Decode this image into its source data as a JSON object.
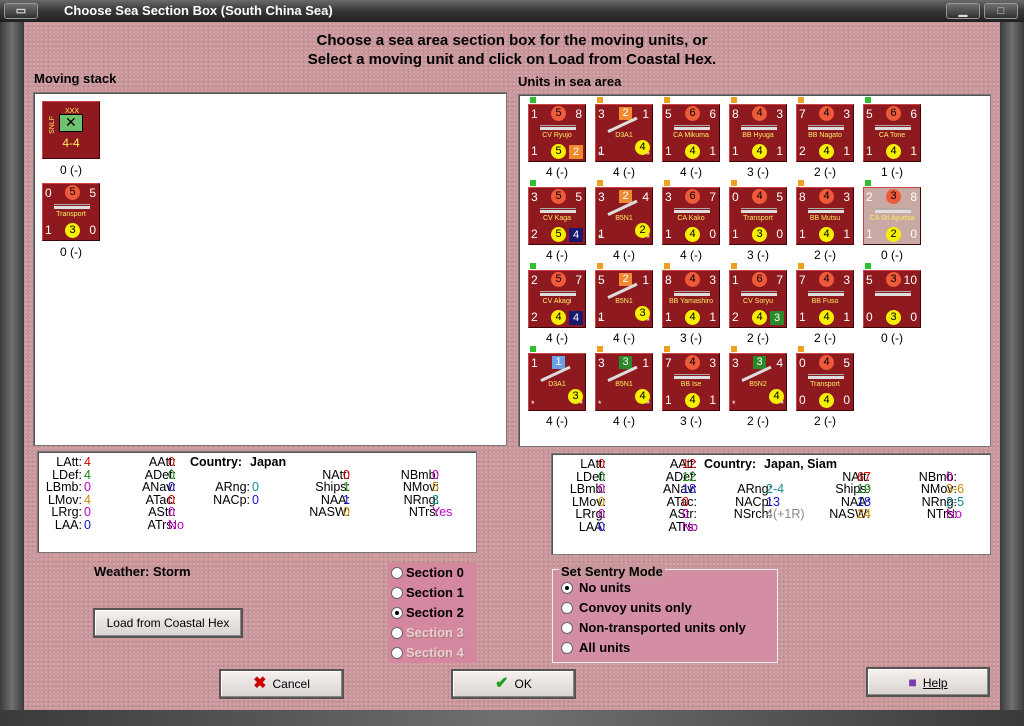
{
  "window": {
    "title": "Choose Sea Section Box (South China Sea)"
  },
  "instructions": {
    "line1": "Choose a sea area section box for the moving units, or",
    "line2": "Select a moving unit and click on Load from Coastal Hex."
  },
  "moving_stack": {
    "label": "Moving stack",
    "units": [
      {
        "id": "snlf",
        "tl": "",
        "tr": "",
        "name": "SNLF",
        "big": "4-4",
        "caption": "0 (-)",
        "mark": "XXX"
      },
      {
        "id": "transport",
        "tl": "0",
        "red": "5",
        "tr": "5",
        "name": "Transport",
        "bl": "1",
        "yel": "3",
        "br": "0",
        "caption": "0 (-)"
      }
    ]
  },
  "sea_units": {
    "label": "Units in sea area",
    "units": [
      {
        "tl": "1",
        "red": "5",
        "tr": "8",
        "name": "CV Ryujo",
        "bl": "1",
        "yel": "5",
        "sq": "2",
        "sqc": "#f08a30",
        "caption": "4 (-)"
      },
      {
        "tl": "3",
        "ora": "2",
        "tr": "1",
        "name": "D3A1",
        "bl": "1",
        "yelr": "4",
        "caption": "4 (-)",
        "plane": true
      },
      {
        "tl": "5",
        "red": "6",
        "tr": "6",
        "name": "CA Mikuma",
        "bl": "1",
        "yel": "4",
        "br": "1",
        "caption": "4 (-)"
      },
      {
        "tl": "8",
        "red": "4",
        "tr": "3",
        "name": "BB Hyuga",
        "bl": "1",
        "yel": "4",
        "br": "1",
        "caption": "3 (-)"
      },
      {
        "tl": "7",
        "red": "4",
        "tr": "3",
        "name": "BB Nagato",
        "bl": "2",
        "yel": "4",
        "br": "1",
        "caption": "2 (-)"
      },
      {
        "tl": "5",
        "red": "6",
        "tr": "6",
        "name": "CA Tone",
        "bl": "1",
        "yel": "4",
        "br": "1",
        "caption": "1 (-)"
      },
      {
        "tl": "3",
        "red": "5",
        "tr": "5",
        "name": "CV Kaga",
        "bl": "2",
        "yel": "5",
        "sq": "4",
        "sqc": "#18186e",
        "caption": "4 (-)"
      },
      {
        "tl": "3",
        "ora": "2",
        "tr": "4",
        "name": "B5N1",
        "bl": "1",
        "yelr": "2",
        "caption": "4 (-)",
        "plane": true
      },
      {
        "tl": "3",
        "red": "6",
        "tr": "7",
        "name": "CA Kako",
        "bl": "1",
        "yel": "4",
        "br": "0",
        "caption": "4 (-)"
      },
      {
        "tl": "0",
        "red": "4",
        "tr": "5",
        "name": "Transport",
        "bl": "1",
        "yel": "3",
        "br": "0",
        "caption": "3 (-)"
      },
      {
        "tl": "8",
        "red": "4",
        "tr": "3",
        "name": "BB Mutsu",
        "bl": "1",
        "yel": "4",
        "br": "1",
        "caption": "2 (-)"
      },
      {
        "tl": "2",
        "red": "3",
        "tr": "8",
        "name": "CA Sri Ayuthia",
        "bl": "1",
        "yel": "2",
        "br": "0",
        "caption": "0 (-)",
        "gray": true,
        "mark": "SIA"
      },
      {
        "tl": "2",
        "red": "5",
        "tr": "7",
        "name": "CV Akagi",
        "bl": "2",
        "yel": "4",
        "sq": "4",
        "sqc": "#18186e",
        "caption": "4 (-)"
      },
      {
        "tl": "5",
        "ora": "2",
        "tr": "1",
        "name": "B5N1",
        "bl": "1",
        "yelr": "3",
        "caption": "4 (-)",
        "plane": true
      },
      {
        "tl": "8",
        "red": "4",
        "tr": "3",
        "name": "BB Yamashiro",
        "bl": "1",
        "yel": "4",
        "br": "1",
        "caption": "3 (-)"
      },
      {
        "tl": "1",
        "red": "6",
        "tr": "7",
        "name": "CV Soryu",
        "bl": "2",
        "yel": "4",
        "sq": "3",
        "sqc": "#2a8a2a",
        "caption": "2 (-)"
      },
      {
        "tl": "7",
        "red": "4",
        "tr": "3",
        "name": "BB Fuso",
        "bl": "1",
        "yel": "4",
        "br": "1",
        "caption": "2 (-)"
      },
      {
        "tl": "5",
        "red": "3",
        "tr": "10",
        "name": "",
        "bl": "0",
        "yel": "3",
        "br": "0",
        "caption": "0 (-)"
      },
      {
        "tl": "1",
        "ora": "1",
        "orac": "#6aa0e8",
        "tr": "",
        "name": "D3A1",
        "bl": "",
        "yelr": "3",
        "caption": "4 (-)",
        "plane": true
      },
      {
        "tl": "3",
        "ora": "3",
        "orac": "#2a8a2a",
        "tr": "1",
        "name": "B5N1",
        "bl": "",
        "yelr": "4",
        "caption": "4 (-)",
        "plane": true
      },
      {
        "tl": "7",
        "red": "4",
        "tr": "3",
        "name": "BB Ise",
        "bl": "1",
        "yel": "4",
        "br": "1",
        "caption": "3 (-)"
      },
      {
        "tl": "3",
        "ora": "3",
        "orac": "#2a8a2a",
        "tr": "4",
        "name": "B5N2",
        "bl": "",
        "yelr": "4",
        "caption": "2 (-)",
        "plane": true
      },
      {
        "tl": "0",
        "red": "4",
        "tr": "5",
        "name": "Transport",
        "bl": "0",
        "yel": "4",
        "br": "0",
        "caption": "2 (-)"
      }
    ]
  },
  "left_stats": {
    "country_label": "Country:",
    "country": "Japan",
    "col1": [
      [
        "LAtt:",
        "4",
        "r"
      ],
      [
        "LDef:",
        "4",
        "gr"
      ],
      [
        "LBmb:",
        "0",
        "p"
      ],
      [
        "LMov:",
        "4",
        "o"
      ],
      [
        "LRrg:",
        "0",
        "p"
      ],
      [
        "LAA:",
        "0",
        "b"
      ]
    ],
    "col2": [
      [
        "AAtt:",
        "0",
        "r"
      ],
      [
        "ADef:",
        "0",
        "gr"
      ],
      [
        "ANav:",
        "0",
        "b"
      ],
      [
        "ATac:",
        "0",
        "r"
      ],
      [
        "AStr:",
        "0",
        "p"
      ],
      [
        "ATrs:",
        "No",
        "p"
      ]
    ],
    "col3": [
      [
        "ARng:",
        "0",
        "t"
      ],
      [
        "NACp:",
        "0",
        "b"
      ]
    ],
    "col4": [
      [
        "NAtt:",
        "0",
        "r"
      ],
      [
        "Ships:",
        "1",
        "gr"
      ],
      [
        "NAA:",
        "1",
        "b"
      ],
      [
        "NASW:",
        "0",
        "o"
      ]
    ],
    "col5": [
      [
        "NBmb:",
        "0",
        "p"
      ],
      [
        "NMov:",
        "5",
        "o"
      ],
      [
        "NRng:",
        "3",
        "t"
      ],
      [
        "NTrs:",
        "Yes",
        "p"
      ]
    ]
  },
  "right_stats": {
    "country_label": "Country:",
    "country": "Japan, Siam",
    "col1": [
      [
        "LAtt:",
        "0",
        "r"
      ],
      [
        "LDef:",
        "0",
        "gr"
      ],
      [
        "LBmb:",
        "0",
        "p"
      ],
      [
        "LMov:",
        "0",
        "o"
      ],
      [
        "LRrg:",
        "0",
        "p"
      ],
      [
        "LAA:",
        "0",
        "b"
      ]
    ],
    "col2": [
      [
        "AAtt:",
        "12",
        "r"
      ],
      [
        "ADef:",
        "12",
        "gr"
      ],
      [
        "ANav:",
        "18",
        "b"
      ],
      [
        "ATac:",
        "0",
        "r"
      ],
      [
        "AStr:",
        "0",
        "p"
      ],
      [
        "ATrs:",
        "No",
        "p"
      ]
    ],
    "col3": [
      [
        "ARng:",
        "2-4",
        "t"
      ],
      [
        "NACp:",
        "13",
        "b"
      ],
      [
        "NSrch:",
        "4(+1R)",
        "gy"
      ]
    ],
    "col4": [
      [
        "NAtt:",
        "67",
        "r"
      ],
      [
        "Ships:",
        "19",
        "gr"
      ],
      [
        "NAA:",
        "18",
        "b"
      ],
      [
        "NASW:",
        "24",
        "o"
      ]
    ],
    "col5": [
      [
        "NBmb:",
        "0",
        "p"
      ],
      [
        "NMov:",
        "3-6",
        "o"
      ],
      [
        "NRng:",
        "2-5",
        "t"
      ],
      [
        "NTrs:",
        "No",
        "p"
      ]
    ]
  },
  "weather": {
    "text": "Weather: Storm"
  },
  "sections": [
    {
      "label": "Section 0",
      "checked": false,
      "disabled": false
    },
    {
      "label": "Section 1",
      "checked": false,
      "disabled": false
    },
    {
      "label": "Section 2",
      "checked": true,
      "disabled": false
    },
    {
      "label": "Section 3",
      "checked": false,
      "disabled": true
    },
    {
      "label": "Section 4",
      "checked": false,
      "disabled": true
    }
  ],
  "sentry": {
    "title": "Set Sentry Mode",
    "options": [
      {
        "label": "No units",
        "checked": true
      },
      {
        "label": "Convoy units only",
        "checked": false
      },
      {
        "label": "Non-transported units only",
        "checked": false
      },
      {
        "label": "All units",
        "checked": false
      }
    ]
  },
  "buttons": {
    "load": "Load from Coastal Hex",
    "cancel": "Cancel",
    "ok": "OK",
    "help": "Help"
  },
  "icons": {
    "cancel": "x-icon",
    "ok": "checkmark-icon",
    "help": "book-icon"
  }
}
